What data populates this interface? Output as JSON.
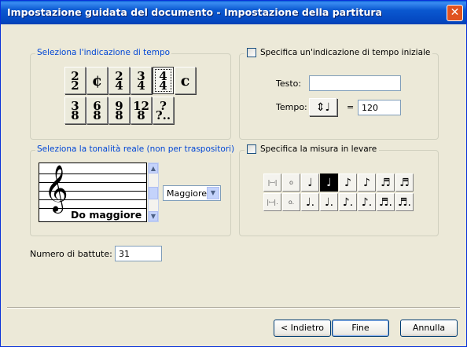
{
  "window": {
    "title": "Impostazione guidata del documento - Impostazione della partitura",
    "close_glyph": "✕"
  },
  "time_sig": {
    "label": "Seleziona l'indicazione di tempo",
    "row1": [
      {
        "top": "2",
        "bottom": "2"
      },
      {
        "single": "¢"
      },
      {
        "top": "2",
        "bottom": "4"
      },
      {
        "top": "3",
        "bottom": "4"
      },
      {
        "top": "4",
        "bottom": "4",
        "selected": true
      },
      {
        "single": "c"
      }
    ],
    "row2": [
      {
        "top": "3",
        "bottom": "8"
      },
      {
        "top": "6",
        "bottom": "8"
      },
      {
        "top": "9",
        "bottom": "8"
      },
      {
        "top": "12",
        "bottom": "8"
      },
      {
        "top": "?",
        "bottom": "?.."
      }
    ]
  },
  "initial_tempo": {
    "checkbox_label": "Specifica un'indicazione di tempo iniziale",
    "text_label": "Testo:",
    "text_value": "",
    "tempo_label": "Tempo:",
    "tempo_button": "⇕♩",
    "equals": "=",
    "tempo_value": "120"
  },
  "key_sig": {
    "label": "Seleziona la tonalità reale (non per traspositori)",
    "clef": "𝄞",
    "key_name": "Do maggiore",
    "scroll_up": "▲",
    "scroll_down": "▼",
    "mode_value": "Maggiore",
    "mode_arrow": "▼"
  },
  "pickup": {
    "checkbox_label": "Specifica la misura in levare",
    "notes_row1": [
      "|𝄩|",
      "o",
      "♩",
      "♩",
      "♪",
      "♪",
      "♬",
      "♬"
    ],
    "notes_row2": [
      "|𝄩|.",
      "o.",
      "♩.",
      "♩.",
      "♪.",
      "♪.",
      "♬.",
      "♬."
    ],
    "selected_index": 3
  },
  "measures": {
    "label": "Numero di battute:",
    "value": "31"
  },
  "buttons": {
    "back": "< Indietro",
    "finish": "Fine",
    "cancel": "Annulla"
  }
}
